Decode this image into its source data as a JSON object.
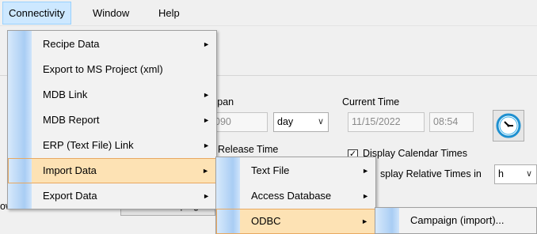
{
  "menubar": {
    "items": [
      "Connectivity",
      "Window",
      "Help"
    ]
  },
  "connectivity_menu": {
    "items": [
      {
        "label": "Recipe Data",
        "submenu": true
      },
      {
        "label": "Export to MS Project (xml)",
        "submenu": false
      },
      {
        "label": "MDB Link",
        "submenu": true
      },
      {
        "label": "MDB Report",
        "submenu": true
      },
      {
        "label": "ERP (Text File) Link",
        "submenu": true
      },
      {
        "label": "Import Data",
        "submenu": true,
        "highlighted": true
      },
      {
        "label": "Export Data",
        "submenu": true
      }
    ]
  },
  "import_menu": {
    "items": [
      {
        "label": "Text File",
        "submenu": true
      },
      {
        "label": "Access Database",
        "submenu": true
      },
      {
        "label": "ODBC",
        "submenu": true,
        "highlighted": true
      }
    ]
  },
  "odbc_menu": {
    "items": [
      {
        "label": "Campaign (import)..."
      }
    ]
  },
  "panel": {
    "span_label": "span",
    "span_value": "090",
    "span_unit": "day",
    "current_time_label": "Current Time",
    "current_date": "11/15/2022",
    "current_clock": "08:54",
    "release_time_label": "t Release Time",
    "display_calendar_label": "Display Calendar Times",
    "display_calendar_checked": "✓",
    "display_relative_label": "splay Relative Times in",
    "relative_unit": "h",
    "show_row_numbers_label": "ow Row Numbers",
    "search_campaigns_label": "Search Campaigns"
  },
  "icons": {
    "arrow": "►",
    "dropdown": "∨"
  }
}
